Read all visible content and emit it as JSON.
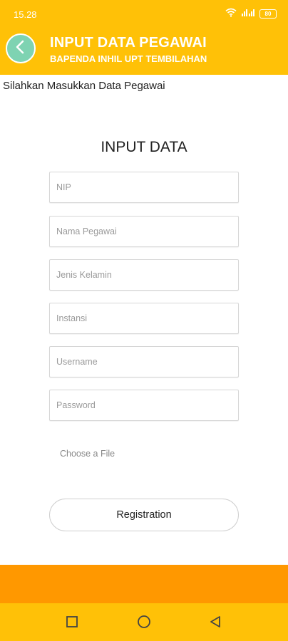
{
  "status_bar": {
    "time": "15.28",
    "battery": "80",
    "icons": [
      "wifi-icon",
      "signal-icon",
      "battery-icon"
    ]
  },
  "header": {
    "title": "INPUT DATA PEGAWAI",
    "subtitle": "BAPENDA INHIL UPT TEMBILAHAN",
    "back_icon": "chevron-left-icon"
  },
  "instruction": "Silahkan Masukkan Data Pegawai",
  "form": {
    "heading": "INPUT DATA",
    "fields": {
      "nip": {
        "placeholder": "NIP",
        "value": ""
      },
      "nama": {
        "placeholder": "Nama Pegawai",
        "value": ""
      },
      "jenis_kelamin": {
        "placeholder": "Jenis Kelamin",
        "value": ""
      },
      "instansi": {
        "placeholder": "Instansi",
        "value": ""
      },
      "username": {
        "placeholder": "Username",
        "value": ""
      },
      "password": {
        "placeholder": "Password",
        "value": ""
      }
    },
    "choose_file": "Choose a File",
    "submit_label": "Registration"
  },
  "navbar": {
    "icons": [
      "recent-apps-icon",
      "home-icon",
      "back-icon"
    ]
  },
  "colors": {
    "header": "#FFC107",
    "bottom_band": "#FF9800",
    "back_button": "#7ed3b2"
  }
}
